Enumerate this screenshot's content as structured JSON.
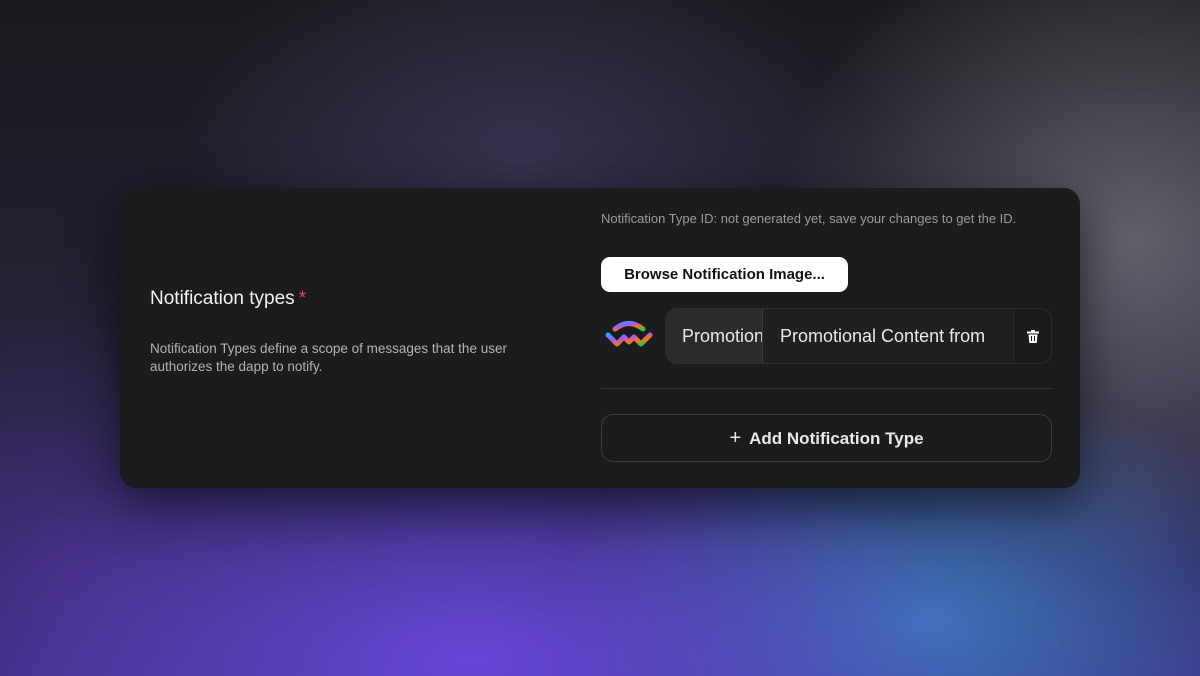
{
  "section": {
    "title": "Notification types",
    "required_mark": "*",
    "description": "Notification Types define a scope of messages that the user authorizes the dapp to notify."
  },
  "notification_type": {
    "id_note": "Notification Type ID: not generated yet, save your changes to get the ID.",
    "browse_label": "Browse Notification Image...",
    "icon": "walletconnect-logo-icon",
    "name_value": "Promotional",
    "description_value": "Promotional Content from",
    "delete_icon": "trash-icon"
  },
  "add_button": {
    "icon": "plus-icon",
    "plus_glyph": "+",
    "label": "Add Notification Type"
  },
  "colors": {
    "card_background": "#1b1c1d",
    "required_star": "#e5484d",
    "browse_button": "#ffffff",
    "logo_gradient": [
      "#3b99fc",
      "#a855f7",
      "#f97316",
      "#22c55e"
    ]
  }
}
